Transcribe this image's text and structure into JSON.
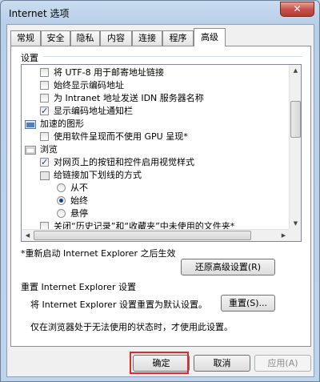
{
  "window": {
    "title": "Internet 选项",
    "close_glyph": "✕"
  },
  "tabs": [
    {
      "label": "常规"
    },
    {
      "label": "安全"
    },
    {
      "label": "隐私"
    },
    {
      "label": "内容"
    },
    {
      "label": "连接"
    },
    {
      "label": "程序"
    },
    {
      "label": "高级",
      "active": true
    }
  ],
  "settings": {
    "group_label": "设置",
    "items": [
      {
        "type": "checkbox",
        "checked": false,
        "label": "将 UTF-8 用于邮寄地址链接"
      },
      {
        "type": "checkbox",
        "checked": false,
        "label": "始终显示编码地址"
      },
      {
        "type": "checkbox",
        "checked": false,
        "label": "为 Intranet 地址发送 IDN 服务器名称"
      },
      {
        "type": "checkbox",
        "checked": true,
        "label": "显示编码地址通知栏"
      },
      {
        "type": "category",
        "label": "加速的图形"
      },
      {
        "type": "checkbox",
        "checked": false,
        "label": "使用软件呈现而不使用 GPU 呈现*"
      },
      {
        "type": "category",
        "label": "浏览"
      },
      {
        "type": "checkbox",
        "checked": true,
        "label": "对网页上的按钮和控件启用视觉样式"
      },
      {
        "type": "category-sub",
        "label": "给链接加下划线的方式"
      },
      {
        "type": "radio",
        "checked": false,
        "label": "从不"
      },
      {
        "type": "radio",
        "checked": true,
        "label": "始终"
      },
      {
        "type": "radio",
        "checked": false,
        "label": "悬停"
      },
      {
        "type": "checkbox",
        "checked": false,
        "label": "关闭“历史记录”和“收藏夹”中未使用的文件夹*"
      }
    ],
    "restart_note": "*重新启动 Internet Explorer 之后生效",
    "restore_button": "还原高级设置(R)"
  },
  "reset": {
    "group_label": "重置 Internet Explorer 设置",
    "description": "将 Internet Explorer 设置重置为默认设置。",
    "reset_button": "重置(S)...",
    "note": "仅在浏览器处于无法使用的状态时，才使用此设置。"
  },
  "footer": {
    "ok": "确定",
    "cancel": "取消",
    "apply": "应用(A)"
  },
  "colors": {
    "highlight": "#e02a2a",
    "accent": "#1e3f88"
  }
}
